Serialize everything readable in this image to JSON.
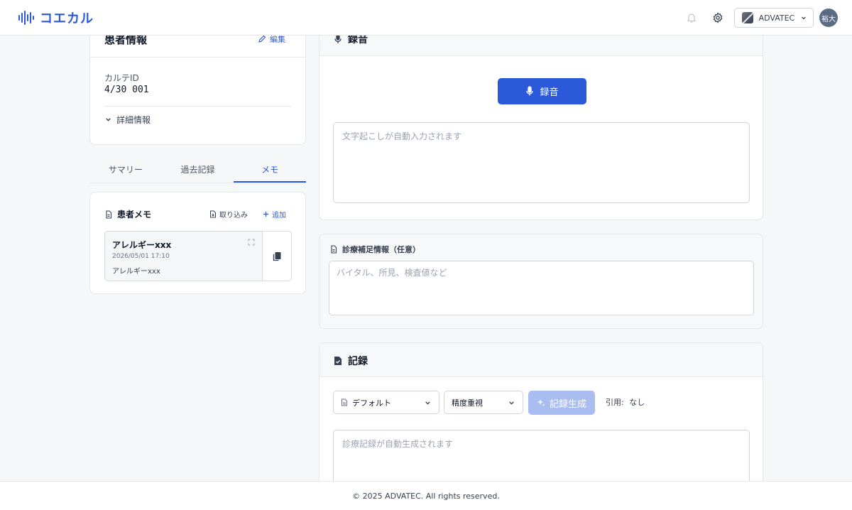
{
  "header": {
    "app_name": "コエカル",
    "org_name": "ADVATEC",
    "avatar_initials": "裕大",
    "icons": [
      "notification-icon",
      "gear-icon",
      "chevron-down-icon"
    ]
  },
  "patient": {
    "title": "患者情報",
    "edit_label": "編集",
    "karte_label": "カルテID",
    "karte_id": "4/30 001",
    "details_label": "詳細情報"
  },
  "tabs": [
    {
      "label": "サマリー",
      "active": false
    },
    {
      "label": "過去記録",
      "active": false
    },
    {
      "label": "メモ",
      "active": true
    }
  ],
  "memo": {
    "title": "患者メモ",
    "import_label": "取り込み",
    "add_label": "追加",
    "items": [
      {
        "title": "アレルギーxxx",
        "date": "2026/05/01 17:10",
        "body": "アレルギーxxx"
      }
    ]
  },
  "recording": {
    "title": "録音",
    "button_label": "録音",
    "transcript_placeholder": "文字起こしが自動入力されます"
  },
  "supplement": {
    "title": "診療補足情報（任意）",
    "placeholder": "バイタル、所見、検査値など"
  },
  "record": {
    "title": "記録",
    "template_value": "デフォルト",
    "mode_value": "精度重視",
    "generate_label": "記録生成",
    "citation_label": "引用:",
    "citation_value": "なし",
    "output_placeholder": "診療記録が自動生成されます"
  },
  "footer": {
    "copyright": "© 2025 ADVATEC. All rights reserved."
  },
  "colors": {
    "accent": "#2b59d9",
    "accent_disabled": "#a9bdf0",
    "background": "#f6f7f9"
  }
}
